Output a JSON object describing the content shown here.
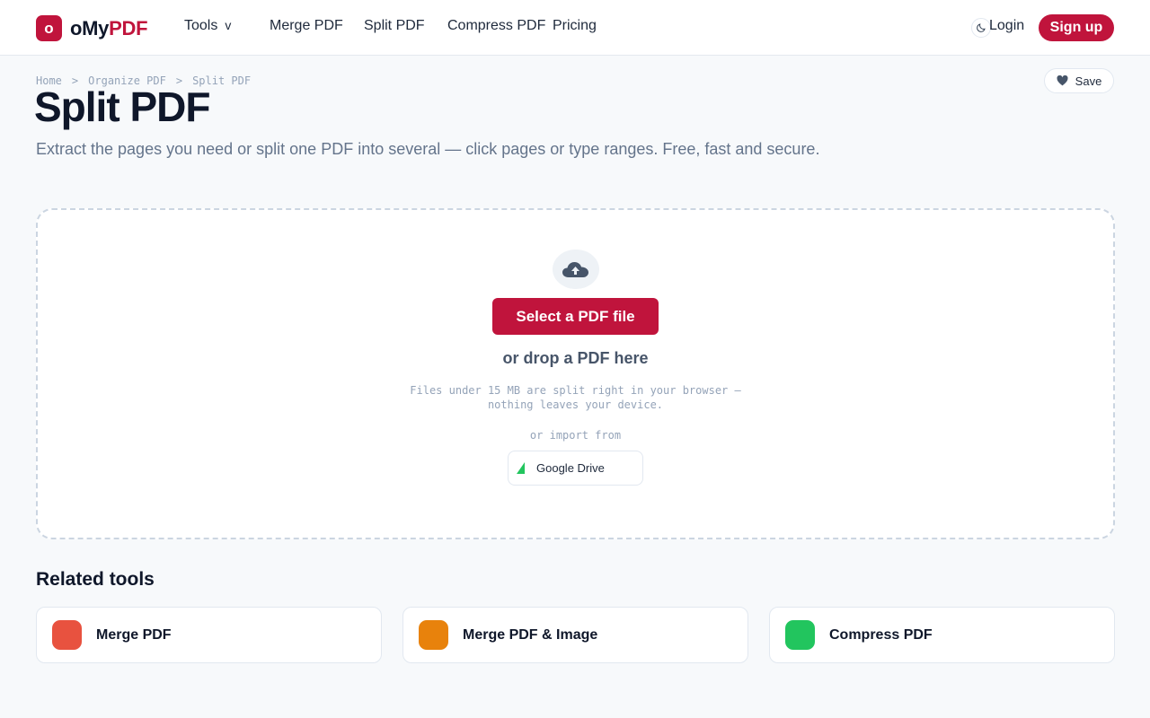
{
  "brand": {
    "mark": "o",
    "name_part1": "oMy",
    "name_part2": "PDF",
    "color": "#c0143c"
  },
  "nav": {
    "tools": "Tools",
    "tools_chevron": "v",
    "merge": "Merge PDF",
    "split": "Split PDF",
    "compress": "Compress PDF",
    "pricing": "Pricing"
  },
  "auth": {
    "login": "Login",
    "signup": "Sign up"
  },
  "icons": {
    "theme": "moon-icon",
    "save": "heart-icon",
    "upload": "cloud-upload-icon",
    "drive": "google-drive-icon"
  },
  "breadcrumb": {
    "items": [
      "Home",
      "Organize PDF",
      "Split PDF"
    ],
    "separator": ">"
  },
  "save_label": "Save",
  "page": {
    "title": "Split PDF",
    "subtitle": "Extract the pages you need or split one PDF into several — click pages or type ranges. Free, fast and secure."
  },
  "dropzone": {
    "select_button": "Select a PDF file",
    "drop_text": "or drop a PDF here",
    "note_line1": "Files under 15 MB are split right in your browser —",
    "note_line2": "nothing leaves your device.",
    "import_label": "or import from",
    "google_drive": "Google Drive"
  },
  "related": {
    "title": "Related tools",
    "tools": [
      {
        "label": "Merge PDF",
        "color": "#e8523f"
      },
      {
        "label": "Merge PDF & Image",
        "color": "#e8820c"
      },
      {
        "label": "Compress PDF",
        "color": "#22c55e"
      }
    ]
  }
}
